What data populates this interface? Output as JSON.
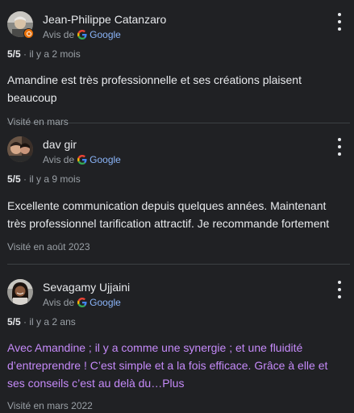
{
  "reviews": [
    {
      "name": "Jean-Philippe Catanzaro",
      "source_prefix": "Avis de",
      "source_name": "Google",
      "rating": "5/5",
      "time": "il y a 2 mois",
      "text": "Amandine est très professionnelle et ses créations plaisent beaucoup",
      "visited": "Visité en mars"
    },
    {
      "name": "dav gir",
      "source_prefix": "Avis de",
      "source_name": "Google",
      "rating": "5/5",
      "time": "il y a 9 mois",
      "text": "Excellente communication depuis quelques années. Maintenant très professionnel tarification attractif. Je recommande fortement",
      "visited": "Visité en août 2023"
    },
    {
      "name": "Sevagamy Ujjaini",
      "source_prefix": "Avis de",
      "source_name": "Google",
      "rating": "5/5",
      "time": "il y a 2 ans",
      "text": "Avec Amandine ; il y a comme une synergie ; et une fluidité d’entreprendre ! C’est simple et a la fois efficace. Grâce à elle et ses conseils c’est au delà du…",
      "more_link": "Plus",
      "visited": "Visité en mars 2022"
    }
  ],
  "separator": "·",
  "colors": {
    "background": "#202124",
    "text": "#e8eaed",
    "secondary": "#9aa0a6",
    "link": "#8ab4f8",
    "visited_link": "#c58af9"
  },
  "icons": [
    "more-vert-icon",
    "google-g-icon",
    "local-guide-badge-icon"
  ]
}
